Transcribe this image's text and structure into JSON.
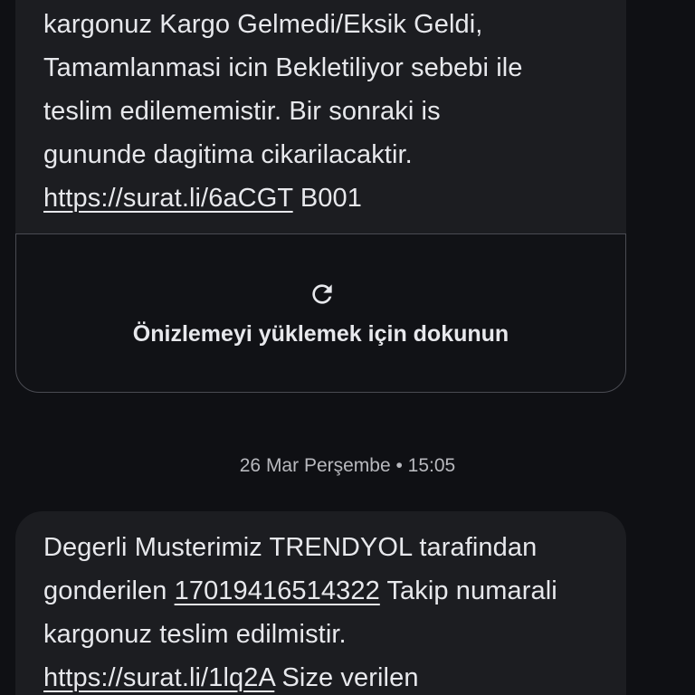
{
  "message_top": {
    "line1": "kargonuz Kargo Gelmedi/Eksik Geldi,",
    "line2": "Tamamlanmasi icin Bekletiliyor sebebi ile",
    "line3": "teslim edilememistir. Bir sonraki is",
    "line4": "gununde dagitima cikarilacaktir.",
    "link": "https://surat.li/6aCGT",
    "after_link": " B001"
  },
  "preview": {
    "icon": "refresh-icon",
    "label": "Önizlemeyi yüklemek için dokunun"
  },
  "timestamp": "26 Mar Perşembe • 15:05",
  "message_bottom": {
    "line1": "Degerli Musterimiz TRENDYOL tarafindan",
    "line2_prefix": "gonderilen ",
    "tracking_number": "17019416514322",
    "line2_suffix": " Takip numarali",
    "line3": "kargonuz teslim edilmistir.",
    "link": "https://surat.li/1lq2A",
    "after_link": " Size verilen"
  },
  "colors": {
    "background": "#0f1014",
    "bubble": "#1c1d21",
    "text": "#e7e8ec",
    "muted_text": "#b8b9be",
    "card_border": "#4a4b52"
  }
}
